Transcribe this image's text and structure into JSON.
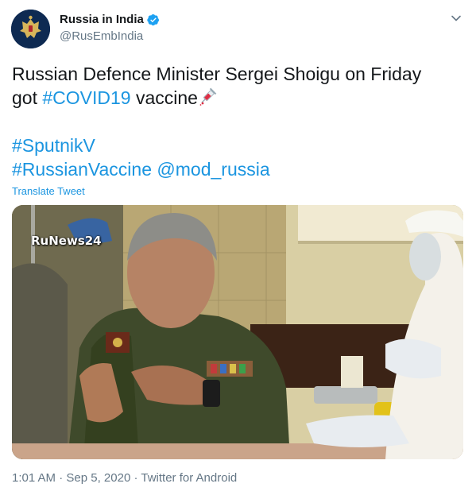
{
  "account": {
    "display_name": "Russia in India",
    "handle": "@RusEmbIndia",
    "avatar_icon": "russian-coat-of-arms-icon",
    "verified": true
  },
  "tweet": {
    "line1": "Russian Defence Minister Sergei Shoigu on Friday",
    "line2_prefix": "got ",
    "hashtag_covid": "#COVID19",
    "line2_suffix": " vaccine",
    "emoji": "syringe-icon",
    "hashtag_sputnik": "#SputnikV",
    "hashtag_vaccine": "#RussianVaccine",
    "mention": "@mod_russia",
    "translate": "Translate Tweet"
  },
  "media": {
    "watermark": "RuNews24",
    "description_icon": "video-still"
  },
  "meta": {
    "time": "1:01 AM",
    "date": "Sep 5, 2020",
    "source": "Twitter for Android",
    "separator": " · "
  },
  "colors": {
    "link": "#1b95e0",
    "verified": "#1da1f2",
    "secondary_text": "#657786"
  }
}
